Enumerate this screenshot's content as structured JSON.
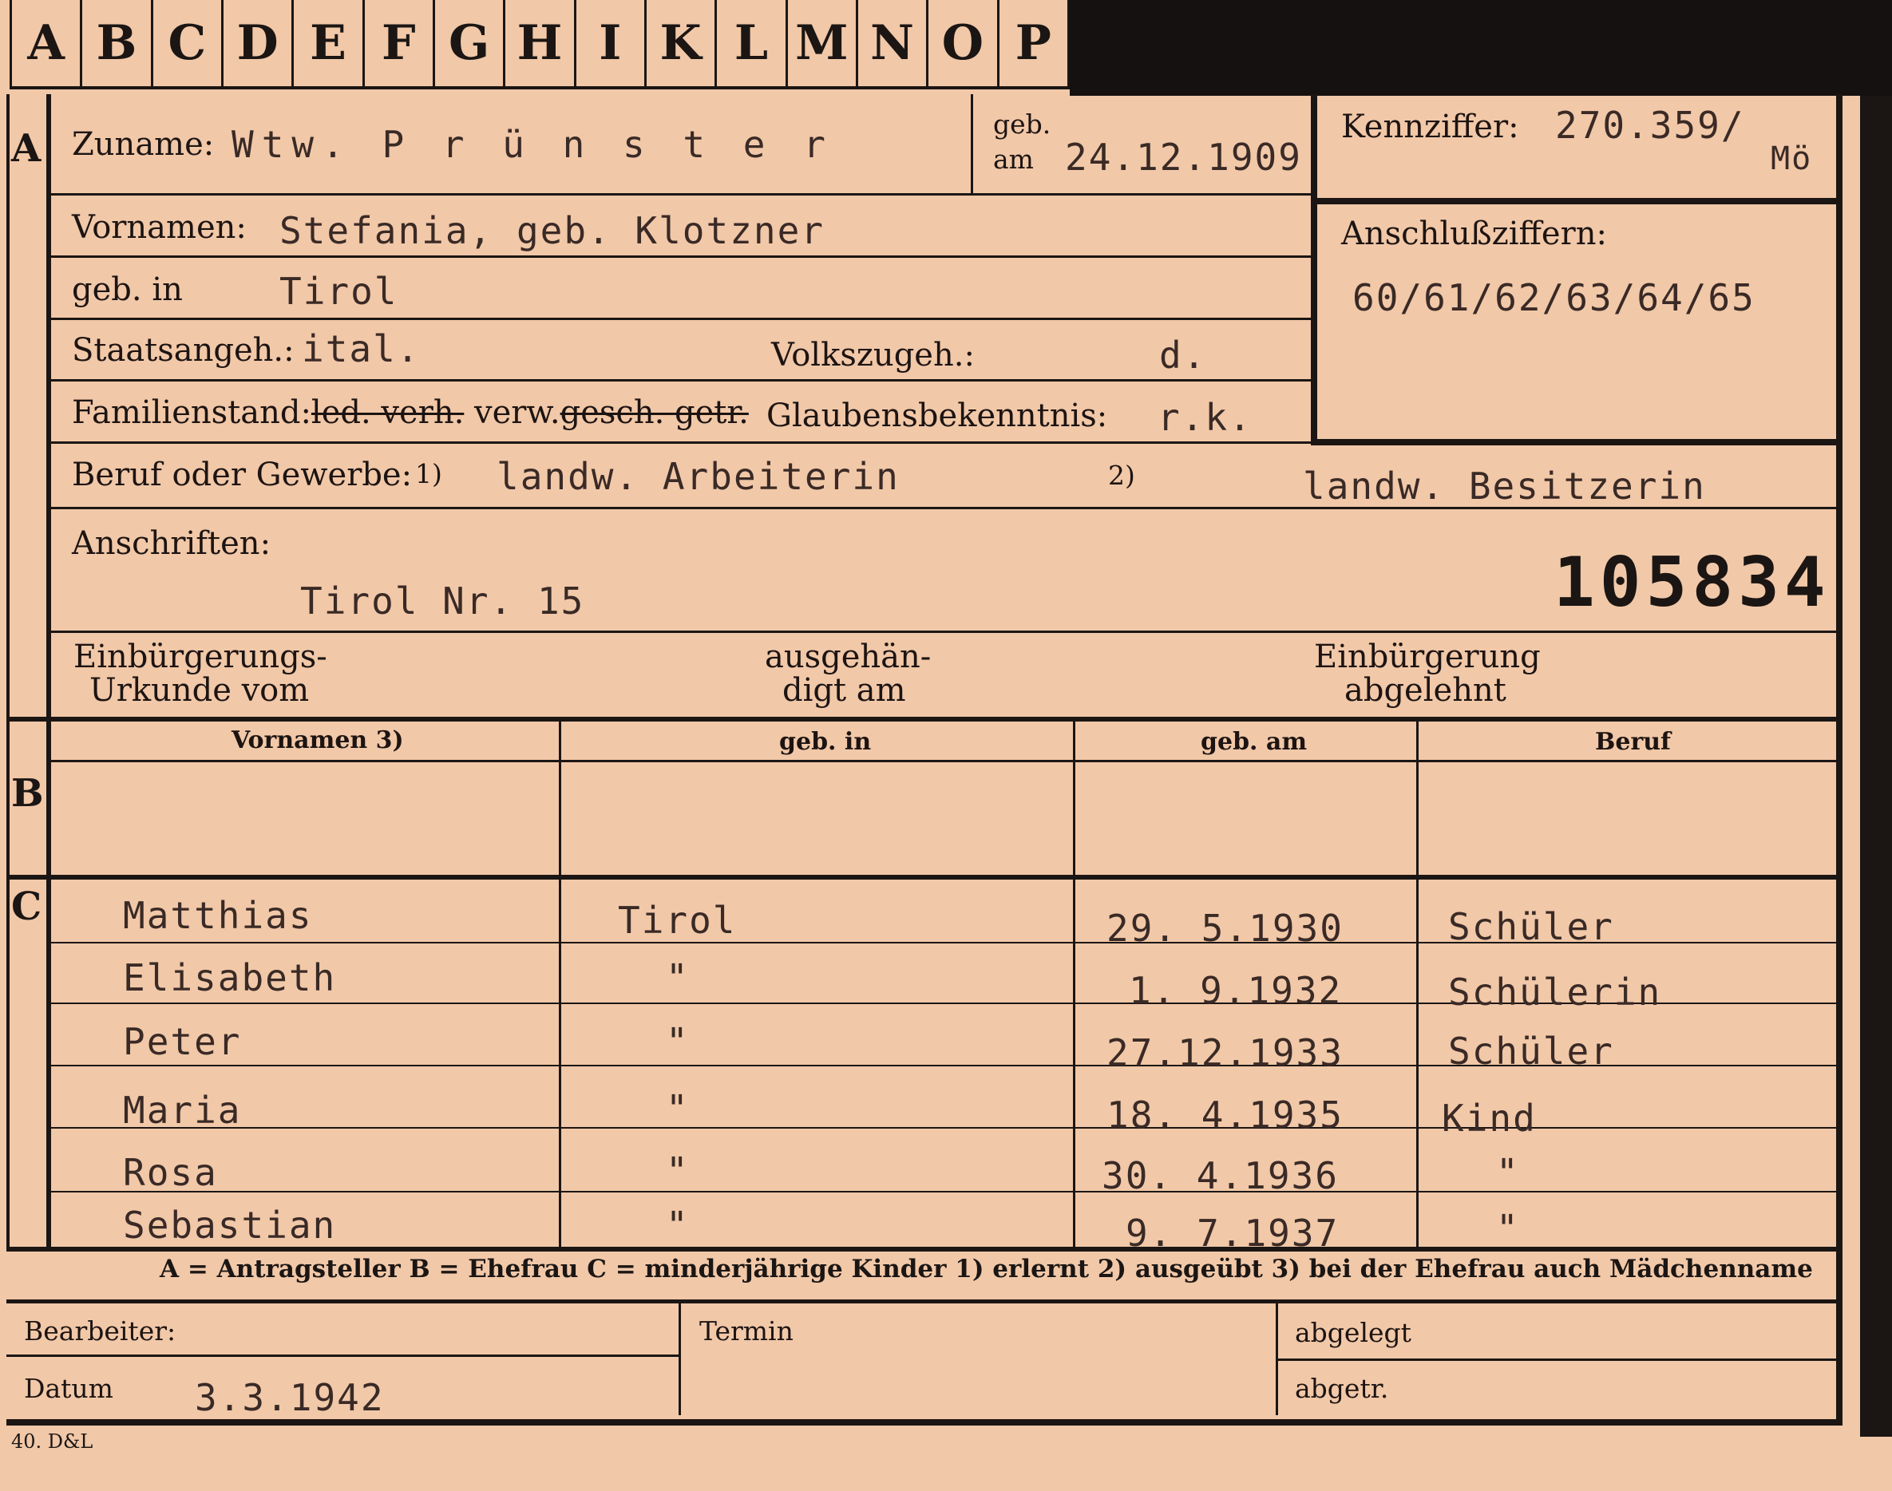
{
  "index_tabs": [
    "A",
    "B",
    "C",
    "D",
    "E",
    "F",
    "G",
    "H",
    "I",
    "K",
    "L",
    "M",
    "N",
    "O",
    "P"
  ],
  "sections": {
    "a": "A",
    "b": "B",
    "c": "C"
  },
  "applicant": {
    "surname_label": "Zuname:",
    "surname_value": "Wtw. P r ü n s t e r",
    "born_on_label_1": "geb.",
    "born_on_label_2": "am",
    "born_on_value": "24.12.1909",
    "kennziffer_label": "Kennziffer:",
    "kennziffer_value": "270.359/",
    "kennziffer_suffix": "Mö",
    "forenames_label": "Vornamen:",
    "forenames_value": "Stefania, geb. Klotzner",
    "born_in_label": "geb. in",
    "born_in_value": "Tirol",
    "anschluss_label": "Anschlußziffern:",
    "anschluss_value": "60/61/62/63/64/65",
    "citizenship_label": "Staatsangeh.:",
    "citizenship_value": "ital.",
    "ethnicity_label": "Volkszugeh.:",
    "ethnicity_value": "d.",
    "marital_label": "Familienstand:",
    "marital_struck_1": "led. verh.",
    "marital_kept": " verw.",
    "marital_struck_2": "gesch. getr.",
    "religion_label": "Glaubensbekenntnis:",
    "religion_value": "r.k.",
    "occupation_label": "Beruf oder Gewerbe:",
    "occupation_mark_1": "1)",
    "occupation_value_1": "landw. Arbeiterin",
    "occupation_mark_2": "2)",
    "occupation_value_2": "landw. Besitzerin",
    "addresses_label": "Anschriften:",
    "addresses_value": "Tirol Nr. 15",
    "stamp_number": "105834",
    "naturalization_label_1": "Einbürgerungs-",
    "naturalization_label_2": "Urkunde vom",
    "handed_label_1": "ausgehän-",
    "handed_label_2": "digt am",
    "rejected_label_1": "Einbürgerung",
    "rejected_label_2": "abgelehnt"
  },
  "table_headers": {
    "forenames": "Vornamen 3)",
    "born_in": "geb. in",
    "born_on": "geb. am",
    "occupation": "Beruf"
  },
  "children": [
    {
      "name": "Matthias",
      "born_in": "Tirol",
      "born_on": "29. 5.1930",
      "occupation": "Schüler"
    },
    {
      "name": "Elisabeth",
      "born_in": "\"",
      "born_on": "1. 9.1932",
      "occupation": "Schülerin"
    },
    {
      "name": "Peter",
      "born_in": "\"",
      "born_on": "27.12.1933",
      "occupation": "Schüler"
    },
    {
      "name": "Maria",
      "born_in": "\"",
      "born_on": "18. 4.1935",
      "occupation": "Kind"
    },
    {
      "name": "Rosa",
      "born_in": "\"",
      "born_on": "30. 4.1936",
      "occupation": "\""
    },
    {
      "name": "Sebastian",
      "born_in": "\"",
      "born_on": "9. 7.1937",
      "occupation": "\""
    }
  ],
  "legend": "A = Antragsteller   B = Ehefrau   C = minderjährige Kinder   1) erlernt   2) ausgeübt   3) bei der Ehefrau auch Mädchenname",
  "footer": {
    "clerk_label": "Bearbeiter:",
    "date_label": "Datum",
    "date_value": "3.3.1942",
    "deadline_label": "Termin",
    "filed_label": "abgelegt",
    "removed_label": "abgetr."
  },
  "print_code": "40. D&L"
}
